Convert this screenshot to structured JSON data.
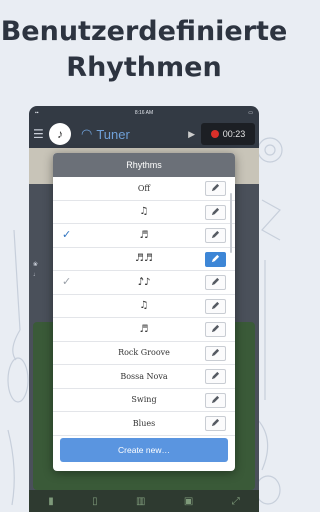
{
  "headline": {
    "line1": "Benutzerdefinierte",
    "line2": "Rhythmen"
  },
  "statusbar": {
    "time": "8:16 AM"
  },
  "appbar": {
    "tuner_label": "Tuner",
    "timer": "00:23"
  },
  "dialog": {
    "title": "Rhythms",
    "create_label": "Create new…",
    "rows": [
      {
        "label": "Off",
        "kind": "text",
        "checked": "",
        "edit_active": false
      },
      {
        "label": "♫",
        "kind": "note",
        "checked": "",
        "edit_active": false
      },
      {
        "label": "♬̈",
        "kind": "note",
        "checked": "✓",
        "check_color": "blue",
        "edit_active": false
      },
      {
        "label": "♬♬",
        "kind": "note",
        "checked": "",
        "edit_active": true
      },
      {
        "label": "♪̂♪",
        "kind": "note",
        "checked": "✓",
        "check_color": "gray",
        "edit_active": false
      },
      {
        "label": "♫",
        "kind": "note",
        "checked": "",
        "edit_active": false
      },
      {
        "label": "♬",
        "kind": "note",
        "checked": "",
        "edit_active": false
      },
      {
        "label": "Rock Groove",
        "kind": "text",
        "checked": "",
        "edit_active": false
      },
      {
        "label": "Bossa Nova",
        "kind": "text",
        "checked": "",
        "edit_active": false
      },
      {
        "label": "Swing",
        "kind": "text",
        "checked": "",
        "edit_active": false
      },
      {
        "label": "Blues",
        "kind": "text",
        "checked": "",
        "edit_active": false
      }
    ]
  },
  "colors": {
    "accent": "#3d86d6",
    "create_button": "#5a95e0",
    "title_bar": "#6b7078",
    "record": "#d9302a"
  }
}
